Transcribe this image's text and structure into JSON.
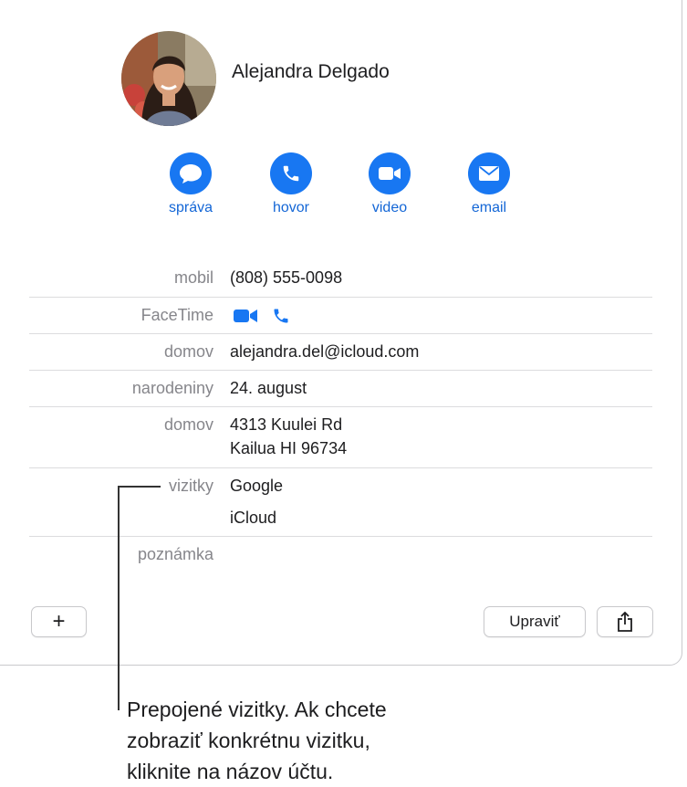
{
  "contact": {
    "name": "Alejandra Delgado"
  },
  "actions": [
    {
      "label": "správa",
      "icon": "message-icon"
    },
    {
      "label": "hovor",
      "icon": "phone-icon"
    },
    {
      "label": "video",
      "icon": "video-icon"
    },
    {
      "label": "email",
      "icon": "envelope-icon"
    }
  ],
  "fields": {
    "mobile_label": "mobil",
    "mobile_value": "(808) 555-0098",
    "facetime_label": "FaceTime",
    "email_label": "domov",
    "email_value": "alejandra.del@icloud.com",
    "birthday_label": "narodeniny",
    "birthday_value": "24. august",
    "address_label": "domov",
    "address_line1": "4313 Kuulei Rd",
    "address_line2": "Kailua HI 96734",
    "cards_label": "vizitky",
    "cards": [
      "Google",
      "iCloud"
    ],
    "note_label": "poznámka"
  },
  "buttons": {
    "add": "+",
    "edit": "Upraviť"
  },
  "callout": {
    "lines": [
      "Prepojené vizitky. Ak chcete",
      "zobraziť konkrétnu vizitku,",
      "kliknite na názov účtu."
    ]
  },
  "colors": {
    "accent": "#1877f2",
    "label_gray": "#86868b"
  }
}
